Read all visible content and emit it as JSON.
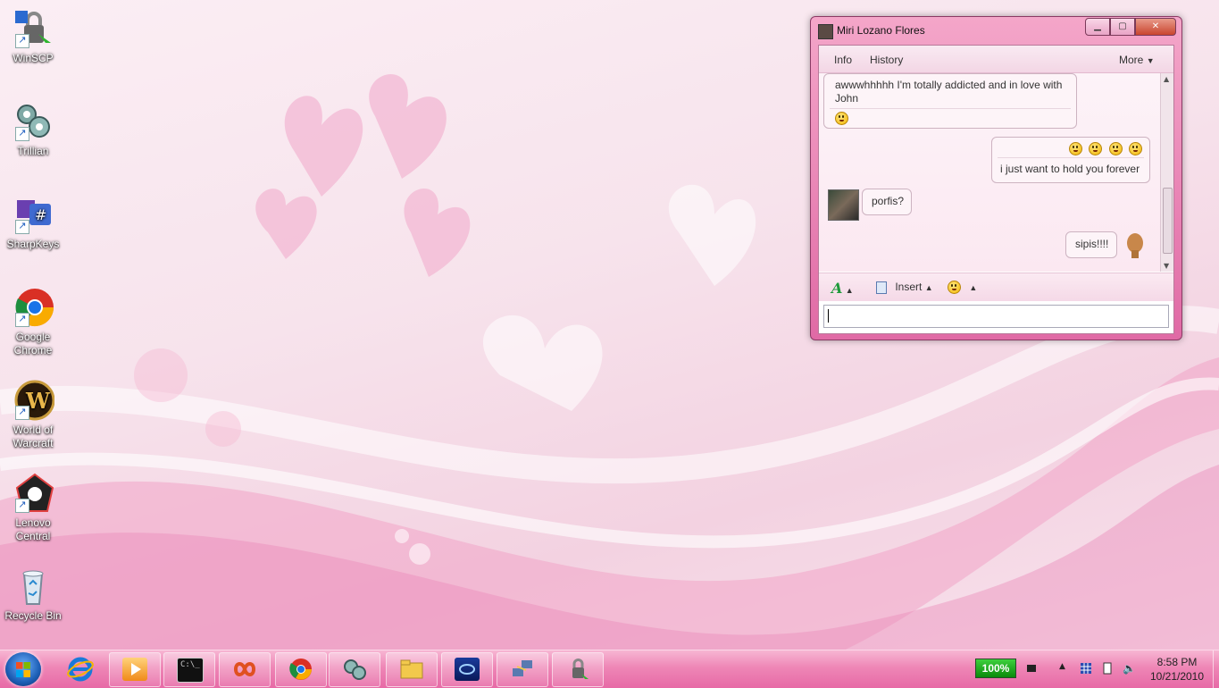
{
  "desktop": {
    "icons": [
      {
        "label": "WinSCP",
        "icon": "winscp-icon"
      },
      {
        "label": "Trillian",
        "icon": "trillian-icon"
      },
      {
        "label": "SharpKeys",
        "icon": "sharpkeys-icon"
      },
      {
        "label": "Google Chrome",
        "icon": "chrome-icon"
      },
      {
        "label": "World of Warcraft",
        "icon": "warcraft-icon"
      },
      {
        "label": "Lenovo Central",
        "icon": "lenovo-icon"
      },
      {
        "label": "Recycle Bin",
        "icon": "recycle-bin-icon"
      }
    ]
  },
  "chat": {
    "title": "Miri Lozano Flores",
    "menu": {
      "info": "Info",
      "history": "History",
      "more": "More"
    },
    "messages": [
      {
        "from": "contact",
        "text": "awwwhhhhh I'm totally addicted and in love with John"
      },
      {
        "from": "me",
        "text": "i just want to hold you forever"
      },
      {
        "from": "contact",
        "text": "porfis?"
      },
      {
        "from": "me",
        "text": "sipis!!!!"
      }
    ],
    "toolbar": {
      "insert": "Insert"
    },
    "input_value": ""
  },
  "taskbar": {
    "battery": "100%",
    "time": "8:58 PM",
    "date": "10/21/2010"
  },
  "colors": {
    "accent": "#e76aa6",
    "window_frame": "#f4a6c9"
  }
}
